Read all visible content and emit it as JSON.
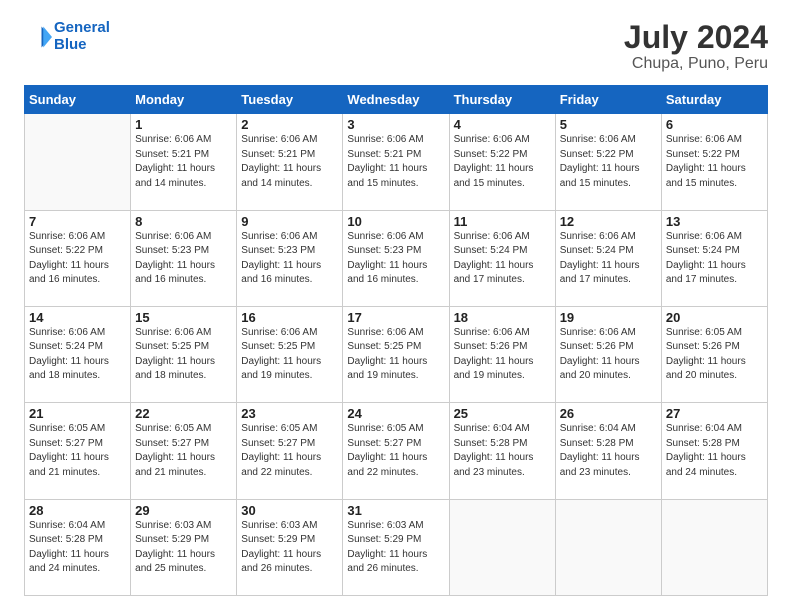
{
  "header": {
    "logo_line1": "General",
    "logo_line2": "Blue",
    "title": "July 2024",
    "subtitle": "Chupa, Puno, Peru"
  },
  "days_of_week": [
    "Sunday",
    "Monday",
    "Tuesday",
    "Wednesday",
    "Thursday",
    "Friday",
    "Saturday"
  ],
  "weeks": [
    [
      {
        "day": "",
        "info": ""
      },
      {
        "day": "1",
        "info": "Sunrise: 6:06 AM\nSunset: 5:21 PM\nDaylight: 11 hours\nand 14 minutes."
      },
      {
        "day": "2",
        "info": "Sunrise: 6:06 AM\nSunset: 5:21 PM\nDaylight: 11 hours\nand 14 minutes."
      },
      {
        "day": "3",
        "info": "Sunrise: 6:06 AM\nSunset: 5:21 PM\nDaylight: 11 hours\nand 15 minutes."
      },
      {
        "day": "4",
        "info": "Sunrise: 6:06 AM\nSunset: 5:22 PM\nDaylight: 11 hours\nand 15 minutes."
      },
      {
        "day": "5",
        "info": "Sunrise: 6:06 AM\nSunset: 5:22 PM\nDaylight: 11 hours\nand 15 minutes."
      },
      {
        "day": "6",
        "info": "Sunrise: 6:06 AM\nSunset: 5:22 PM\nDaylight: 11 hours\nand 15 minutes."
      }
    ],
    [
      {
        "day": "7",
        "info": "Sunrise: 6:06 AM\nSunset: 5:22 PM\nDaylight: 11 hours\nand 16 minutes."
      },
      {
        "day": "8",
        "info": "Sunrise: 6:06 AM\nSunset: 5:23 PM\nDaylight: 11 hours\nand 16 minutes."
      },
      {
        "day": "9",
        "info": "Sunrise: 6:06 AM\nSunset: 5:23 PM\nDaylight: 11 hours\nand 16 minutes."
      },
      {
        "day": "10",
        "info": "Sunrise: 6:06 AM\nSunset: 5:23 PM\nDaylight: 11 hours\nand 16 minutes."
      },
      {
        "day": "11",
        "info": "Sunrise: 6:06 AM\nSunset: 5:24 PM\nDaylight: 11 hours\nand 17 minutes."
      },
      {
        "day": "12",
        "info": "Sunrise: 6:06 AM\nSunset: 5:24 PM\nDaylight: 11 hours\nand 17 minutes."
      },
      {
        "day": "13",
        "info": "Sunrise: 6:06 AM\nSunset: 5:24 PM\nDaylight: 11 hours\nand 17 minutes."
      }
    ],
    [
      {
        "day": "14",
        "info": "Sunrise: 6:06 AM\nSunset: 5:24 PM\nDaylight: 11 hours\nand 18 minutes."
      },
      {
        "day": "15",
        "info": "Sunrise: 6:06 AM\nSunset: 5:25 PM\nDaylight: 11 hours\nand 18 minutes."
      },
      {
        "day": "16",
        "info": "Sunrise: 6:06 AM\nSunset: 5:25 PM\nDaylight: 11 hours\nand 19 minutes."
      },
      {
        "day": "17",
        "info": "Sunrise: 6:06 AM\nSunset: 5:25 PM\nDaylight: 11 hours\nand 19 minutes."
      },
      {
        "day": "18",
        "info": "Sunrise: 6:06 AM\nSunset: 5:26 PM\nDaylight: 11 hours\nand 19 minutes."
      },
      {
        "day": "19",
        "info": "Sunrise: 6:06 AM\nSunset: 5:26 PM\nDaylight: 11 hours\nand 20 minutes."
      },
      {
        "day": "20",
        "info": "Sunrise: 6:05 AM\nSunset: 5:26 PM\nDaylight: 11 hours\nand 20 minutes."
      }
    ],
    [
      {
        "day": "21",
        "info": "Sunrise: 6:05 AM\nSunset: 5:27 PM\nDaylight: 11 hours\nand 21 minutes."
      },
      {
        "day": "22",
        "info": "Sunrise: 6:05 AM\nSunset: 5:27 PM\nDaylight: 11 hours\nand 21 minutes."
      },
      {
        "day": "23",
        "info": "Sunrise: 6:05 AM\nSunset: 5:27 PM\nDaylight: 11 hours\nand 22 minutes."
      },
      {
        "day": "24",
        "info": "Sunrise: 6:05 AM\nSunset: 5:27 PM\nDaylight: 11 hours\nand 22 minutes."
      },
      {
        "day": "25",
        "info": "Sunrise: 6:04 AM\nSunset: 5:28 PM\nDaylight: 11 hours\nand 23 minutes."
      },
      {
        "day": "26",
        "info": "Sunrise: 6:04 AM\nSunset: 5:28 PM\nDaylight: 11 hours\nand 23 minutes."
      },
      {
        "day": "27",
        "info": "Sunrise: 6:04 AM\nSunset: 5:28 PM\nDaylight: 11 hours\nand 24 minutes."
      }
    ],
    [
      {
        "day": "28",
        "info": "Sunrise: 6:04 AM\nSunset: 5:28 PM\nDaylight: 11 hours\nand 24 minutes."
      },
      {
        "day": "29",
        "info": "Sunrise: 6:03 AM\nSunset: 5:29 PM\nDaylight: 11 hours\nand 25 minutes."
      },
      {
        "day": "30",
        "info": "Sunrise: 6:03 AM\nSunset: 5:29 PM\nDaylight: 11 hours\nand 26 minutes."
      },
      {
        "day": "31",
        "info": "Sunrise: 6:03 AM\nSunset: 5:29 PM\nDaylight: 11 hours\nand 26 minutes."
      },
      {
        "day": "",
        "info": ""
      },
      {
        "day": "",
        "info": ""
      },
      {
        "day": "",
        "info": ""
      }
    ]
  ]
}
